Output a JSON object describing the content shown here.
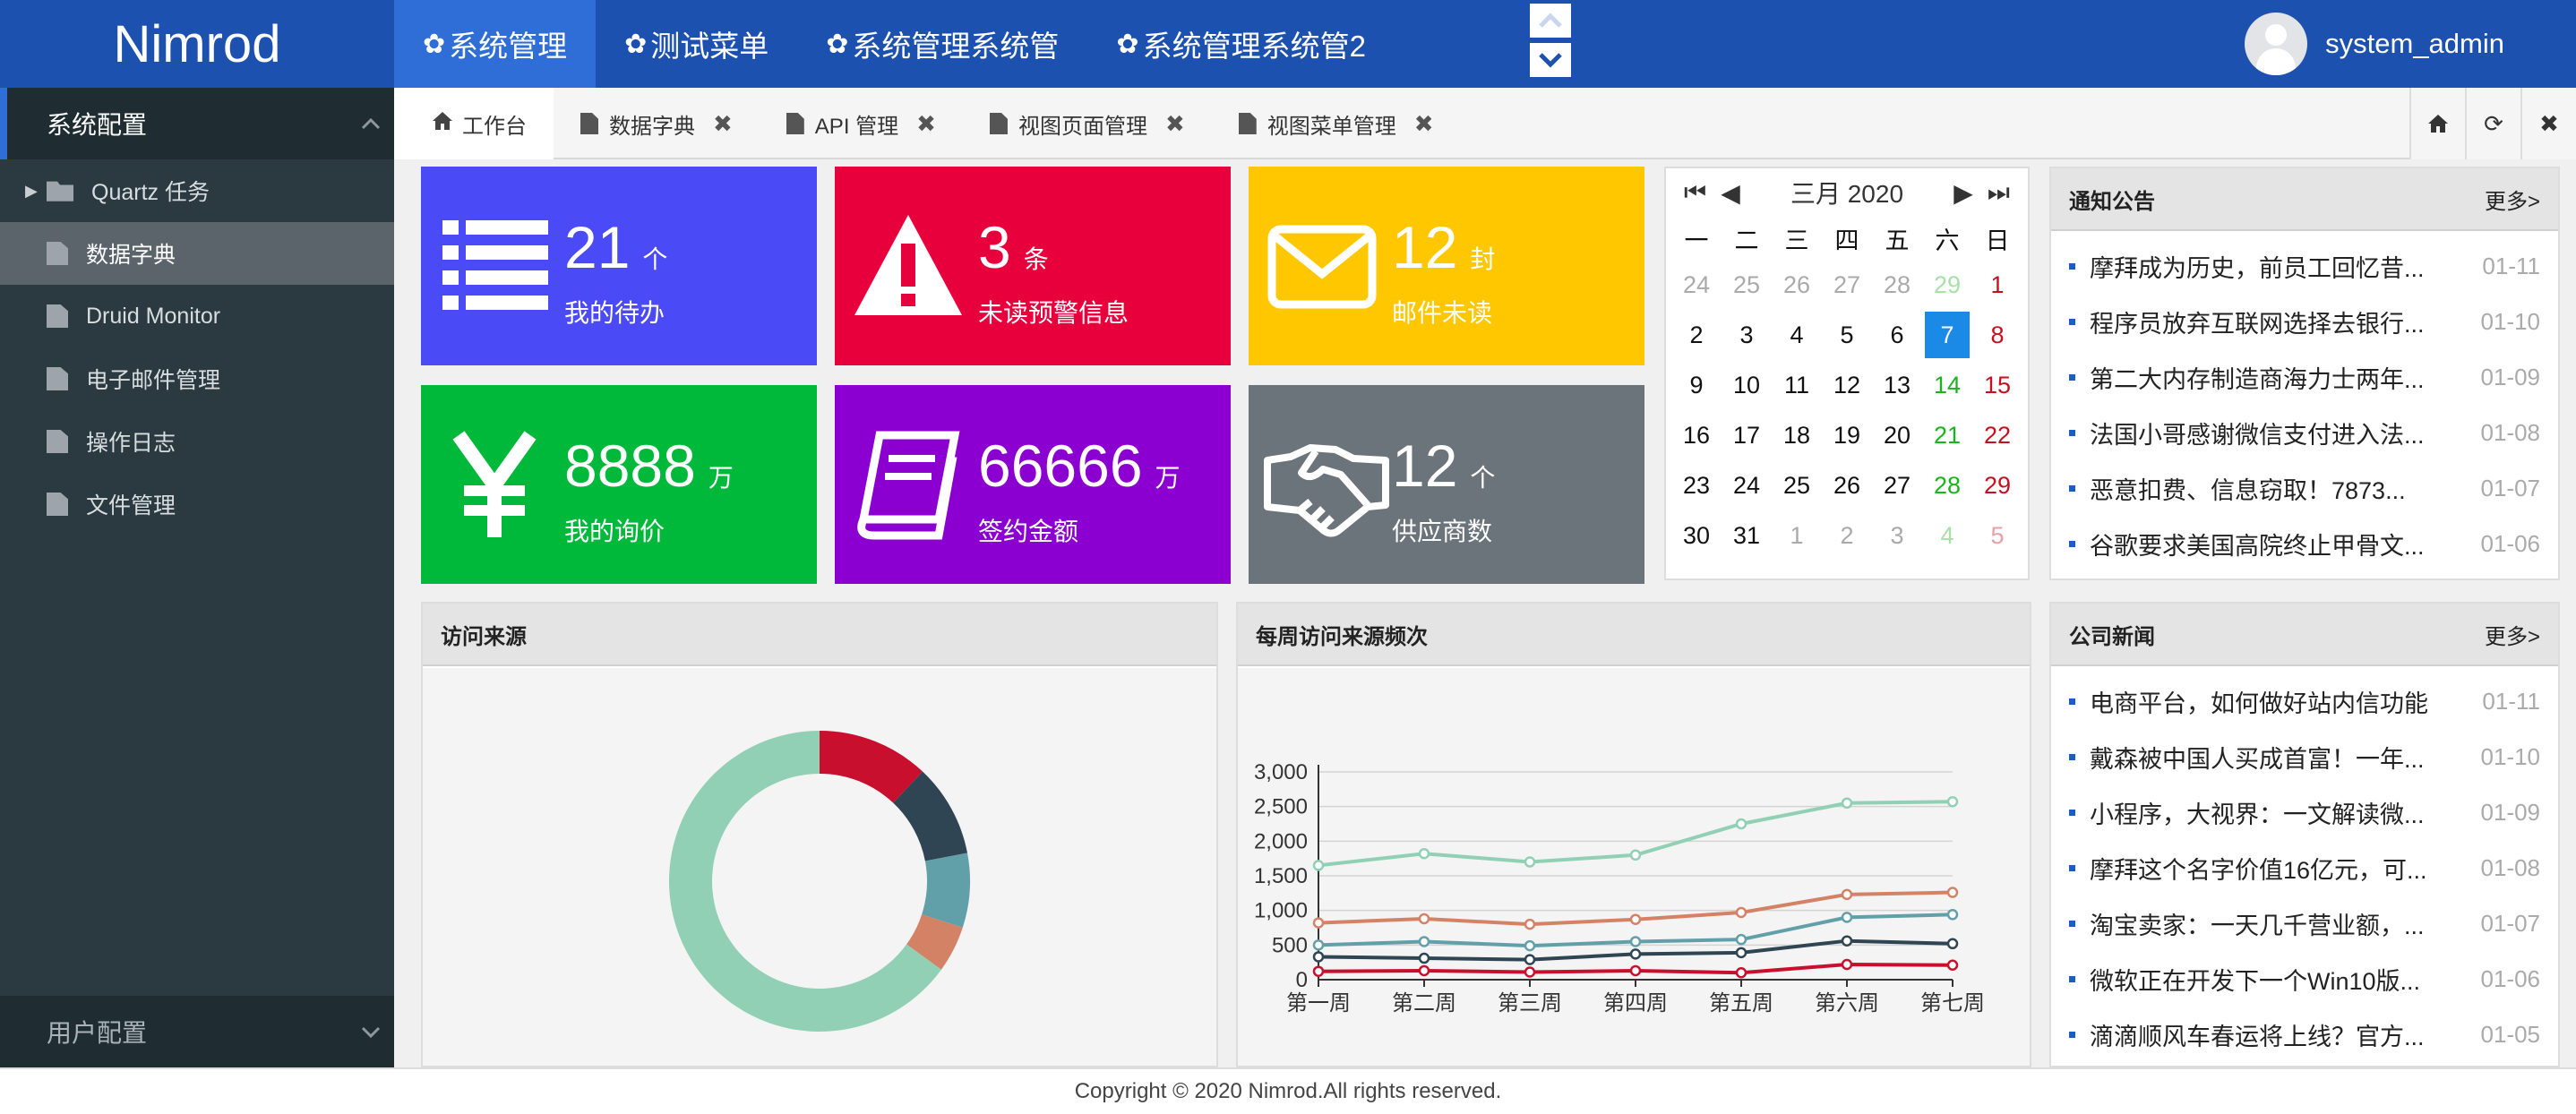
{
  "app": {
    "logo": "Nimrod"
  },
  "topnav": [
    {
      "label": "系统管理",
      "active": true
    },
    {
      "label": "测试菜单",
      "active": false
    },
    {
      "label": "系统管理系统管",
      "active": false
    },
    {
      "label": "系统管理系统管2",
      "active": false
    }
  ],
  "user": {
    "name": "system_admin"
  },
  "sidebar": {
    "section": "系统配置",
    "items": [
      {
        "label": "Quartz 任务",
        "icon": "folder-icon",
        "active": false
      },
      {
        "label": "数据字典",
        "icon": "doc-icon",
        "active": true
      },
      {
        "label": "Druid Monitor",
        "icon": "doc-icon",
        "active": false
      },
      {
        "label": "电子邮件管理",
        "icon": "doc-icon",
        "active": false
      },
      {
        "label": "操作日志",
        "icon": "doc-icon",
        "active": false
      },
      {
        "label": "文件管理",
        "icon": "doc-icon",
        "active": false
      }
    ],
    "footer_section": "用户配置"
  },
  "tabs": [
    {
      "label": "工作台",
      "icon": "home-icon",
      "active": true,
      "closable": false
    },
    {
      "label": "数据字典",
      "icon": "doc-icon",
      "active": false,
      "closable": true
    },
    {
      "label": "API 管理",
      "icon": "doc-icon",
      "active": false,
      "closable": true
    },
    {
      "label": "视图页面管理",
      "icon": "doc-icon",
      "active": false,
      "closable": true
    },
    {
      "label": "视图菜单管理",
      "icon": "doc-icon",
      "active": false,
      "closable": true
    }
  ],
  "stats": [
    {
      "value": "21",
      "unit": "个",
      "label": "我的待办",
      "color": "#4a4af7",
      "icon": "list-icon"
    },
    {
      "value": "3",
      "unit": "条",
      "label": "未读预警信息",
      "color": "#e8003c",
      "icon": "warning-icon"
    },
    {
      "value": "12",
      "unit": "封",
      "label": "邮件未读",
      "color": "#ffc700",
      "icon": "mail-icon"
    },
    {
      "value": "8888",
      "unit": "万",
      "label": "我的询价",
      "color": "#00b83a",
      "icon": "yen-icon"
    },
    {
      "value": "66666",
      "unit": "万",
      "label": "签约金额",
      "color": "#8b00d1",
      "icon": "book-icon"
    },
    {
      "value": "12",
      "unit": "个",
      "label": "供应商数",
      "color": "#6b737b",
      "icon": "handshake-icon"
    }
  ],
  "calendar": {
    "title": "三月 2020",
    "weekdays": [
      "一",
      "二",
      "三",
      "四",
      "五",
      "六",
      "日"
    ],
    "today": "7",
    "weeks": [
      [
        "24",
        "25",
        "26",
        "27",
        "28",
        "29",
        "1"
      ],
      [
        "2",
        "3",
        "4",
        "5",
        "6",
        "7",
        "8"
      ],
      [
        "9",
        "10",
        "11",
        "12",
        "13",
        "14",
        "15"
      ],
      [
        "16",
        "17",
        "18",
        "19",
        "20",
        "21",
        "22"
      ],
      [
        "23",
        "24",
        "25",
        "26",
        "27",
        "28",
        "29"
      ],
      [
        "30",
        "31",
        "1",
        "2",
        "3",
        "4",
        "5"
      ]
    ]
  },
  "notices": {
    "title": "通知公告",
    "more": "更多>",
    "items": [
      {
        "title": "摩拜成为历史，前员工回忆昔...",
        "date": "01-11"
      },
      {
        "title": "程序员放弃互联网选择去银行...",
        "date": "01-10"
      },
      {
        "title": "第二大内存制造商海力士两年...",
        "date": "01-09"
      },
      {
        "title": "法国小哥感谢微信支付进入法...",
        "date": "01-08"
      },
      {
        "title": "恶意扣费、信息窃取！7873...",
        "date": "01-07"
      },
      {
        "title": "谷歌要求美国高院终止甲骨文...",
        "date": "01-06"
      }
    ]
  },
  "company_news": {
    "title": "公司新闻",
    "more": "更多>",
    "items": [
      {
        "title": "电商平台，如何做好站内信功能",
        "date": "01-11"
      },
      {
        "title": "戴森被中国人买成首富！一年...",
        "date": "01-10"
      },
      {
        "title": "小程序，大视界：一文解读微...",
        "date": "01-09"
      },
      {
        "title": "摩拜这个名字价值16亿元，可...",
        "date": "01-08"
      },
      {
        "title": "淘宝卖家：一天几千营业额，...",
        "date": "01-07"
      },
      {
        "title": "微软正在开发下一个Win10版...",
        "date": "01-06"
      },
      {
        "title": "滴滴顺风车春运将上线？官方...",
        "date": "01-05"
      }
    ]
  },
  "donut_panel": {
    "title": "访问来源"
  },
  "line_panel": {
    "title": "每周访问来源频次"
  },
  "chart_data": [
    {
      "type": "pie",
      "title": "访问来源",
      "values": [
        12,
        10,
        8,
        5,
        65
      ],
      "colors": [
        "#c8102e",
        "#2f4554",
        "#61a0a8",
        "#d48265",
        "#91d0b4"
      ]
    },
    {
      "type": "line",
      "title": "每周访问来源频次",
      "categories": [
        "第一周",
        "第二周",
        "第三周",
        "第四周",
        "第五周",
        "第六周",
        "第七周"
      ],
      "ylim": [
        0,
        3000
      ],
      "yticks": [
        "0",
        "500",
        "1,000",
        "1,500",
        "2,000",
        "2,500",
        "3,000"
      ],
      "series": [
        {
          "color": "#91d0b4",
          "values": [
            1650,
            1820,
            1700,
            1800,
            2250,
            2550,
            2570
          ]
        },
        {
          "color": "#d48265",
          "values": [
            820,
            880,
            800,
            870,
            970,
            1230,
            1260
          ]
        },
        {
          "color": "#61a0a8",
          "values": [
            500,
            550,
            490,
            550,
            580,
            900,
            940
          ]
        },
        {
          "color": "#2f4554",
          "values": [
            330,
            310,
            290,
            370,
            390,
            560,
            520
          ]
        },
        {
          "color": "#c8102e",
          "values": [
            120,
            130,
            110,
            130,
            100,
            220,
            210
          ]
        }
      ]
    }
  ],
  "footer": {
    "text": "Copyright © 2020 Nimrod.All rights reserved."
  }
}
